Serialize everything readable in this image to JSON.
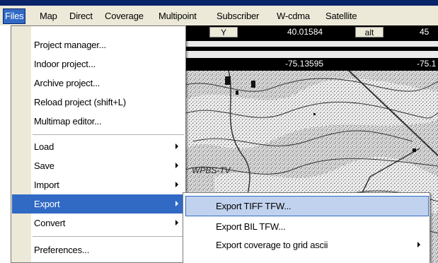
{
  "menubar": {
    "items": [
      {
        "label": "Files"
      },
      {
        "label": "Map"
      },
      {
        "label": "Direct"
      },
      {
        "label": "Coverage"
      },
      {
        "label": "Multipoint"
      },
      {
        "label": "Subscriber"
      },
      {
        "label": "W-cdma"
      },
      {
        "label": "Satellite"
      }
    ]
  },
  "coords": {
    "y_label": "Y",
    "y_value": "40.01584",
    "alt_label": "alt",
    "alt_value": "45",
    "x_value": "-75.13595",
    "x_value2": "-75.1"
  },
  "files_menu": {
    "items": [
      {
        "label": "Project manager..."
      },
      {
        "label": "Indoor project..."
      },
      {
        "label": "Archive project..."
      },
      {
        "label": "Reload project (shift+L)"
      },
      {
        "label": "Multimap editor..."
      },
      {
        "label": "Load"
      },
      {
        "label": "Save"
      },
      {
        "label": "Import"
      },
      {
        "label": "Export"
      },
      {
        "label": "Convert"
      },
      {
        "label": "Preferences..."
      }
    ]
  },
  "export_submenu": {
    "items": [
      {
        "label": "Export TIFF TFW..."
      },
      {
        "label": "Export BIL TFW..."
      },
      {
        "label": "Export coverage to grid ascii"
      }
    ]
  },
  "colors": {
    "highlight": "#316ac5",
    "menubar_bg": "#ece9d8",
    "title_strip": "#0a246a"
  }
}
